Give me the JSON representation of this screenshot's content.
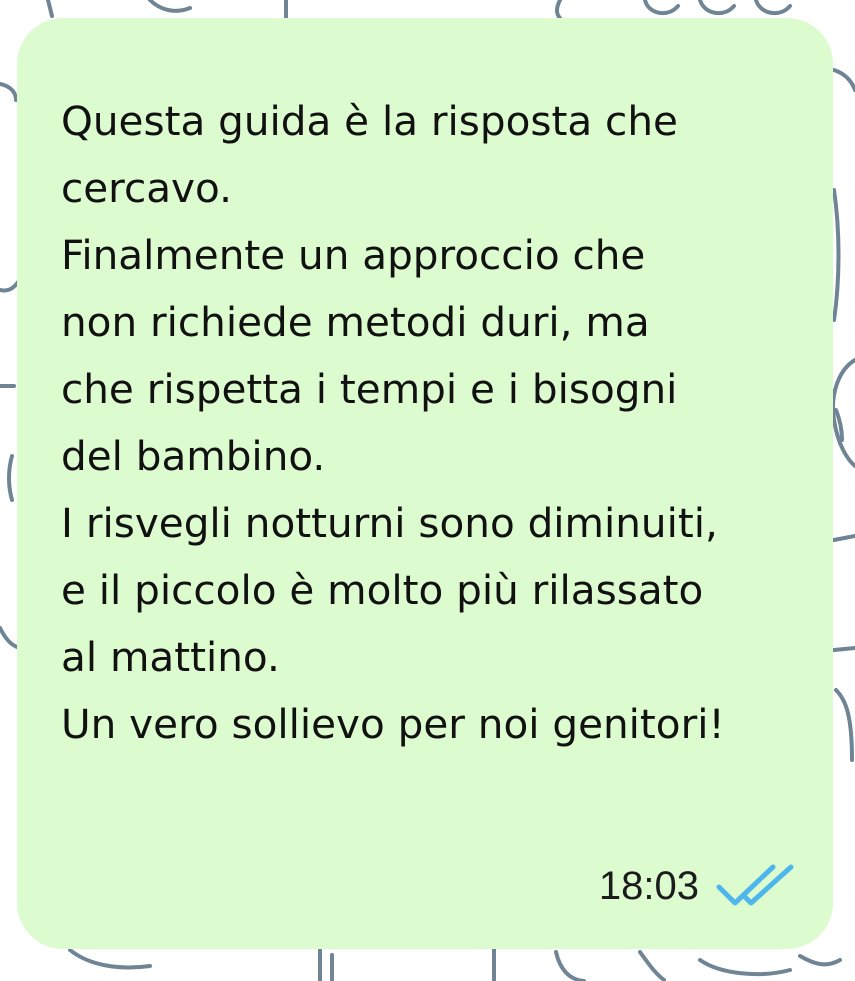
{
  "message": {
    "lines": [
      "Questa guida è la risposta che",
      "cercavo.",
      "Finalmente un approccio che",
      "non richiede metodi duri, ma",
      "che rispetta i tempi e i bisogni",
      "del bambino.",
      "I risvegli notturni sono diminuiti,",
      "e il piccolo è molto più rilassato",
      "al mattino.",
      "Un vero sollievo per noi genitori!"
    ],
    "timestamp": "18:03",
    "status_icon": "double-check-read-icon"
  },
  "colors": {
    "bubble_background": "#dcfcd0",
    "wallpaper_background": "#ffffff",
    "wallpaper_doodle": "#6f8494",
    "read_ticks": "#4fb6ec",
    "text": "#111111"
  }
}
